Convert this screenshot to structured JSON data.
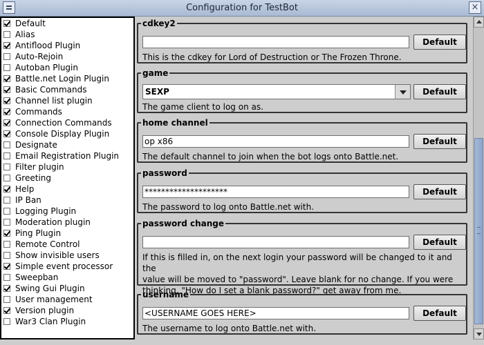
{
  "window": {
    "title": "Configuration for TestBot"
  },
  "plugins": [
    {
      "label": "Default",
      "checked": true
    },
    {
      "label": "Alias",
      "checked": false
    },
    {
      "label": "Antiflood Plugin",
      "checked": true
    },
    {
      "label": "Auto-Rejoin",
      "checked": false
    },
    {
      "label": "Autoban Plugin",
      "checked": false
    },
    {
      "label": "Battle.net Login Plugin",
      "checked": true
    },
    {
      "label": "Basic Commands",
      "checked": true
    },
    {
      "label": "Channel list plugin",
      "checked": true
    },
    {
      "label": "Commands",
      "checked": true
    },
    {
      "label": "Connection Commands",
      "checked": true
    },
    {
      "label": "Console Display Plugin",
      "checked": true
    },
    {
      "label": "Designate",
      "checked": false
    },
    {
      "label": "Email Registration Plugin",
      "checked": false
    },
    {
      "label": "Filter plugin",
      "checked": false
    },
    {
      "label": "Greeting",
      "checked": false
    },
    {
      "label": "Help",
      "checked": true
    },
    {
      "label": "IP Ban",
      "checked": false
    },
    {
      "label": "Logging Plugin",
      "checked": false
    },
    {
      "label": "Moderation plugin",
      "checked": false
    },
    {
      "label": "Ping Plugin",
      "checked": true
    },
    {
      "label": "Remote Control",
      "checked": false
    },
    {
      "label": "Show invisible users",
      "checked": false
    },
    {
      "label": "Simple event processor",
      "checked": true
    },
    {
      "label": "Sweepban",
      "checked": false
    },
    {
      "label": "Swing Gui Plugin",
      "checked": true
    },
    {
      "label": "User management",
      "checked": false
    },
    {
      "label": "Version plugin",
      "checked": true
    },
    {
      "label": "War3 Clan Plugin",
      "checked": false
    }
  ],
  "settings": {
    "default_label": "Default",
    "cdkey2": {
      "label": "cdkey2",
      "value": "",
      "description": "This is the cdkey for Lord of Destruction or The Frozen Throne."
    },
    "game": {
      "label": "game",
      "value": "SEXP",
      "description": "The game client to log on as."
    },
    "home_channel": {
      "label": "home channel",
      "value": "op x86",
      "description": "The default channel to join when the bot logs onto Battle.net."
    },
    "password": {
      "label": "password",
      "value": "********************",
      "description": "The password to log onto Battle.net with."
    },
    "password_change": {
      "label": "password change",
      "value": "",
      "description_lines": [
        "If this is filled in, on the next login your password will be changed to it and the",
        "value will be moved to \"password\".  Leave blank for no change.  If you were",
        "thinking, \"How do I set a blank password?\" get away from me."
      ]
    },
    "username": {
      "label": "username",
      "value": "<USERNAME GOES HERE>",
      "description": "The username to log onto Battle.net with."
    }
  }
}
